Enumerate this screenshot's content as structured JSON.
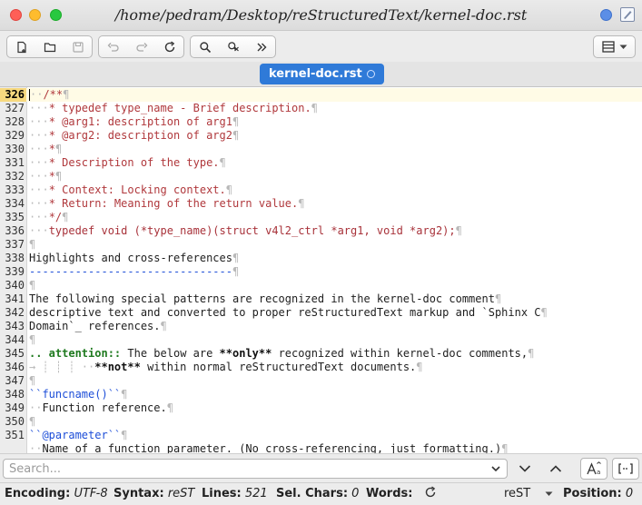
{
  "window": {
    "title": "/home/pedram/Desktop/reStructuredText/kernel-doc.rst"
  },
  "tab": {
    "label": "kernel-doc.rst"
  },
  "editor": {
    "current_line": "326",
    "lines": [
      {
        "n": "326"
      },
      {
        "n": "327"
      },
      {
        "n": "328"
      },
      {
        "n": "329"
      },
      {
        "n": "330"
      },
      {
        "n": "331"
      },
      {
        "n": "332"
      },
      {
        "n": "333"
      },
      {
        "n": "334"
      },
      {
        "n": "335"
      },
      {
        "n": "336"
      },
      {
        "n": "337"
      },
      {
        "n": "338"
      },
      {
        "n": "339"
      },
      {
        "n": "340"
      },
      {
        "n": "341"
      },
      {
        "n": "342"
      },
      {
        "n": "343"
      },
      {
        "n": "344"
      },
      {
        "n": "345"
      },
      {
        "n": "346"
      },
      {
        "n": "347"
      },
      {
        "n": "348"
      },
      {
        "n": "349"
      },
      {
        "n": "350"
      },
      {
        "n": "351"
      }
    ],
    "code": {
      "l326": "/**",
      "l327": "* typedef type_name - Brief description.",
      "l328": "* @arg1: description of arg1",
      "l329": "* @arg2: description of arg2",
      "l330": "*",
      "l331": "* Description of the type.",
      "l332": "*",
      "l333": "* Context: Locking context.",
      "l334": "* Return: Meaning of the return value.",
      "l335": "*/",
      "l336": "typedef void (*type_name)(struct v4l2_ctrl *arg1, void *arg2);",
      "l338": "Highlights and cross-references",
      "l339": "-------------------------------",
      "l341": "The following special patterns are recognized in the kernel-doc comment",
      "l342": "descriptive text and converted to proper reStructuredText markup and `Sphinx C",
      "l343": "Domain`_ references.",
      "l345_directive": ".. attention::",
      "l345_a": "The below are",
      "l345_b": "**only**",
      "l345_c": "recognized within kernel-doc comments,",
      "l346_b": "**not**",
      "l346_c": "within normal reStructuredText documents.",
      "l348": "``funcname()``",
      "l349": "Function reference.",
      "l351_a": "``@parameter``",
      "l352": "Name of a function parameter. (No cross-referencing, just formatting.)"
    }
  },
  "search": {
    "placeholder": "Search..."
  },
  "status": {
    "encoding_label": "Encoding:",
    "encoding_value": "UTF-8",
    "syntax_label": "Syntax:",
    "syntax_value": "reST",
    "lines_label": "Lines:",
    "lines_value": "521",
    "selchars_label": "Sel. Chars:",
    "selchars_value": "0",
    "words_label": "Words:",
    "mode_value": "reST",
    "position_label": "Position:",
    "position_value": "0"
  },
  "colors": {
    "accent": "#2f7ad8",
    "current_line_number": "#f7d97f",
    "comment": "#b0383c",
    "link": "#1d4ed8"
  }
}
